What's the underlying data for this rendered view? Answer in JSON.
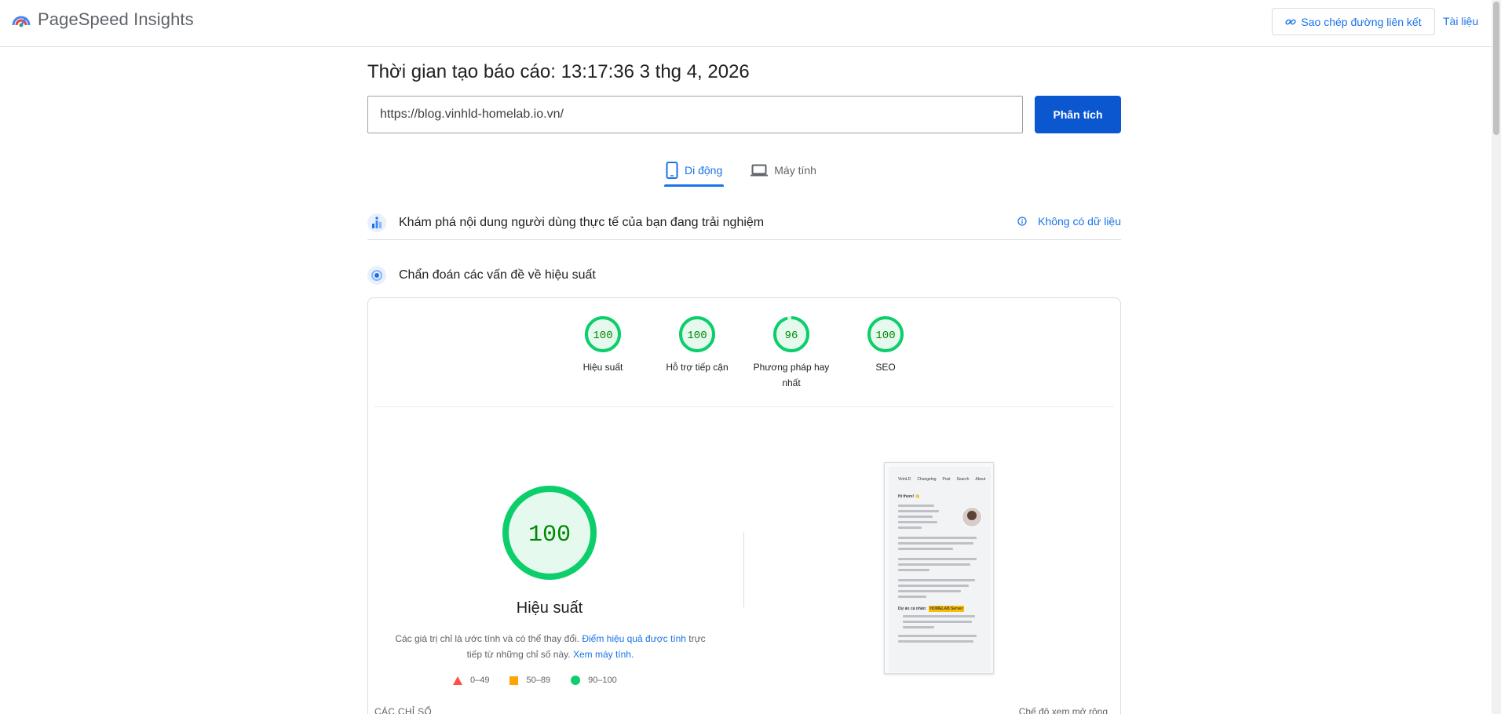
{
  "header": {
    "app_title": "PageSpeed Insights",
    "copy_link_label": "Sao chép đường liên kết",
    "docs_label": "Tài liệu"
  },
  "report": {
    "time_label": "Thời gian tạo báo cáo: 13:17:36 3 thg 4, 2026",
    "url_value": "https://blog.vinhld-homelab.io.vn/",
    "analyze_label": "Phân tích"
  },
  "tabs": [
    {
      "label": "Di động",
      "active": true
    },
    {
      "label": "Máy tính",
      "active": false
    }
  ],
  "crux": {
    "title": "Khám phá nội dung người dùng thực tế của bạn đang trải nghiệm",
    "no_data_label": "Không có dữ liệu"
  },
  "diagnose": {
    "title": "Chẩn đoán các vấn đề về hiệu suất"
  },
  "scores": [
    {
      "label": "Hiệu suất",
      "value": 100
    },
    {
      "label": "Hỗ trợ tiếp cận",
      "value": 100
    },
    {
      "label": "Phương pháp hay nhất",
      "value": 96
    },
    {
      "label": "SEO",
      "value": 100
    }
  ],
  "performance": {
    "score": 100,
    "label": "Hiệu suất",
    "disclaimer_before": "Các giá trị chỉ là ước tính và có thể thay đổi. ",
    "disclaimer_link1": "Điểm hiệu quả được tính",
    "disclaimer_middle": " trực tiếp từ những chỉ số này. ",
    "disclaimer_link2": "Xem máy tính."
  },
  "legend": [
    {
      "range": "0–49",
      "color": "#ff4e42"
    },
    {
      "range": "50–89",
      "color": "#ffa400"
    },
    {
      "range": "90–100",
      "color": "#0cce6b"
    }
  ],
  "screenshot": {
    "nav": [
      "VinhLD",
      "Changelog",
      "Post",
      "Search",
      "About"
    ],
    "greeting": "Hi there! 👋",
    "project_label": "Dự án cá nhân:",
    "project_name": "HOMELAB Server"
  },
  "footer": {
    "metrics_label": "CÁC CHỈ SỐ",
    "expand_label": "Chế độ xem mở rộng"
  },
  "colors": {
    "accent": "#1a73e8",
    "button": "#0b57d0",
    "good": "#0cce6b",
    "good_text": "#008800"
  }
}
